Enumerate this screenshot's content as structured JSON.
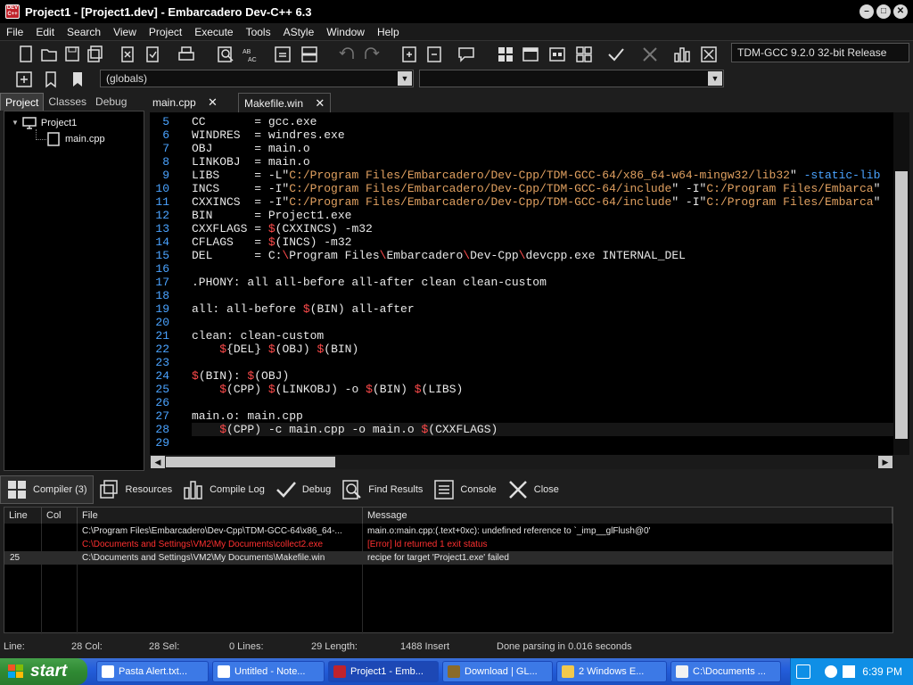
{
  "window": {
    "title": "Project1 - [Project1.dev] - Embarcadero Dev-C++ 6.3",
    "app_icon_text": "DEV C++"
  },
  "menu": [
    "File",
    "Edit",
    "Search",
    "View",
    "Project",
    "Execute",
    "Tools",
    "AStyle",
    "Window",
    "Help"
  ],
  "toolbar": {
    "compiler": "TDM-GCC 9.2.0 32-bit Release",
    "globals": "(globals)"
  },
  "left_tabs": [
    "Project",
    "Classes",
    "Debug"
  ],
  "tree": {
    "project": "Project1",
    "file": "main.cpp"
  },
  "editor_tabs": [
    {
      "label": "main.cpp",
      "close": "✕"
    },
    {
      "label": "Makefile.win",
      "close": "✕"
    }
  ],
  "code": [
    {
      "n": "5",
      "t": "CC       = gcc.exe"
    },
    {
      "n": "6",
      "t": "WINDRES  = windres.exe"
    },
    {
      "n": "7",
      "t": "OBJ      = main.o"
    },
    {
      "n": "8",
      "t": "LINKOBJ  = main.o"
    },
    {
      "n": "9",
      "t": "LIBS     = -L\"C:/Program Files/Embarcadero/Dev-Cpp/TDM-GCC-64/x86_64-w64-mingw32/lib32\" -static-lib"
    },
    {
      "n": "10",
      "t": "INCS     = -I\"C:/Program Files/Embarcadero/Dev-Cpp/TDM-GCC-64/include\" -I\"C:/Program Files/Embarcad"
    },
    {
      "n": "11",
      "t": "CXXINCS  = -I\"C:/Program Files/Embarcadero/Dev-Cpp/TDM-GCC-64/include\" -I\"C:/Program Files/Embarcad"
    },
    {
      "n": "12",
      "t": "BIN      = Project1.exe"
    },
    {
      "n": "13",
      "t": "CXXFLAGS = $(CXXINCS) -m32"
    },
    {
      "n": "14",
      "t": "CFLAGS   = $(INCS) -m32"
    },
    {
      "n": "15",
      "t": "DEL      = C:\\Program Files\\Embarcadero\\Dev-Cpp\\devcpp.exe INTERNAL_DEL"
    },
    {
      "n": "16",
      "t": ""
    },
    {
      "n": "17",
      "t": ".PHONY: all all-before all-after clean clean-custom"
    },
    {
      "n": "18",
      "t": ""
    },
    {
      "n": "19",
      "t": "all: all-before $(BIN) all-after"
    },
    {
      "n": "20",
      "t": ""
    },
    {
      "n": "21",
      "t": "clean: clean-custom"
    },
    {
      "n": "22",
      "t": "    ${DEL} $(OBJ) $(BIN)"
    },
    {
      "n": "23",
      "t": ""
    },
    {
      "n": "24",
      "t": "$(BIN): $(OBJ)"
    },
    {
      "n": "25",
      "t": "    $(CPP) $(LINKOBJ) -o $(BIN) $(LIBS)"
    },
    {
      "n": "26",
      "t": ""
    },
    {
      "n": "27",
      "t": "main.o: main.cpp"
    },
    {
      "n": "28",
      "t": "    $(CPP) -c main.cpp -o main.o $(CXXFLAGS)"
    },
    {
      "n": "29",
      "t": ""
    }
  ],
  "bottom_tabs": [
    "Compiler (3)",
    "Resources",
    "Compile Log",
    "Debug",
    "Find Results",
    "Console",
    "Close"
  ],
  "messages": {
    "headers": [
      "Line",
      "Col",
      "File",
      "Message"
    ],
    "rows": [
      {
        "line": "",
        "col": "",
        "file": "C:\\Program Files\\Embarcadero\\Dev-Cpp\\TDM-GCC-64\\x86_64-...",
        "message": "main.o:main.cpp:(.text+0xc): undefined reference to `_imp__glFlush@0'",
        "error": false
      },
      {
        "line": "",
        "col": "",
        "file": "C:\\Documents and Settings\\VM2\\My Documents\\collect2.exe",
        "message": "[Error] ld returned 1 exit status",
        "error": true
      },
      {
        "line": "25",
        "col": "",
        "file": "C:\\Documents and Settings\\VM2\\My Documents\\Makefile.win",
        "message": "recipe for target 'Project1.exe' failed",
        "error": false
      }
    ]
  },
  "status": {
    "line": "Line:",
    "col": "28 Col:",
    "sel": "28 Sel:",
    "lines": "0 Lines:",
    "length": "29 Length:",
    "insert": "1488 Insert",
    "parse": "Done parsing in 0.016 seconds"
  },
  "taskbar": {
    "start": "start",
    "tasks": [
      "Pasta Alert.txt...",
      "Untitled - Note...",
      "Project1 - Emb...",
      "Download | GL...",
      "2 Windows E...",
      "C:\\Documents ..."
    ],
    "clock": "6:39 PM"
  },
  "colors": {
    "keyword_blue": "#4aa3ff",
    "string_orange": "#e0a060",
    "dollar_red": "#ff4b4b",
    "error_red": "#ff3030"
  }
}
